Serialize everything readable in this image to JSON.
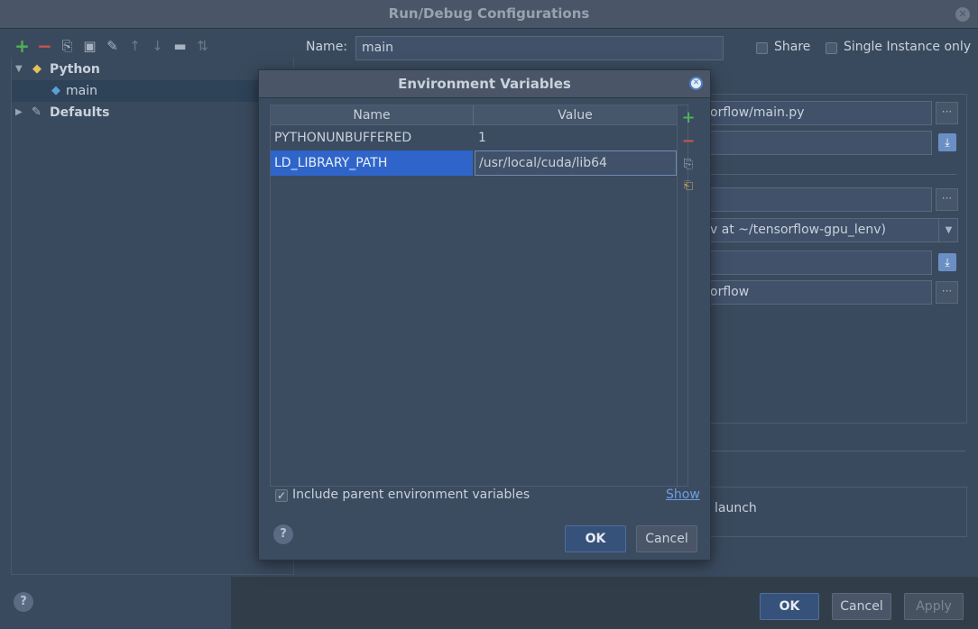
{
  "window": {
    "title": "Run/Debug Configurations"
  },
  "toolbar": {
    "items": [
      {
        "name": "add-icon",
        "glyph": "+"
      },
      {
        "name": "remove-icon",
        "glyph": "−"
      },
      {
        "name": "copy-icon",
        "glyph": "⎘"
      },
      {
        "name": "save-icon",
        "glyph": "▣"
      },
      {
        "name": "wrench-icon",
        "glyph": "✎"
      },
      {
        "name": "arrow-up-icon",
        "glyph": "↑"
      },
      {
        "name": "arrow-down-icon",
        "glyph": "↓"
      },
      {
        "name": "folder-icon",
        "glyph": "▬"
      },
      {
        "name": "sort-icon",
        "glyph": "⇅"
      }
    ]
  },
  "tree": {
    "python": "Python",
    "main": "main",
    "defaults": "Defaults"
  },
  "form": {
    "name_label": "Name:",
    "name_value": "main",
    "share_label": "Share",
    "single_instance_label": "Single Instance only",
    "script_path": "orflow/main.py",
    "interpreter": "v at ~/tensorflow-gpu_lenv)",
    "working_dir": "orflow",
    "launch_text": "launch"
  },
  "footer": {
    "ok": "OK",
    "cancel": "Cancel",
    "apply": "Apply"
  },
  "dialog": {
    "title": "Environment Variables",
    "columns": {
      "name": "Name",
      "value": "Value"
    },
    "rows": [
      {
        "name": "PYTHONUNBUFFERED",
        "value": "1"
      },
      {
        "name": "LD_LIBRARY_PATH",
        "value": "/usr/local/cuda/lib64"
      }
    ],
    "include_parent_label": "Include parent environment variables",
    "include_parent_checked": true,
    "show_link": "Show",
    "ok": "OK",
    "cancel": "Cancel"
  },
  "colors": {
    "accent": "#2f65ca",
    "add_green": "#4fb05a",
    "remove_red": "#c75450",
    "link": "#6d9fe0"
  }
}
